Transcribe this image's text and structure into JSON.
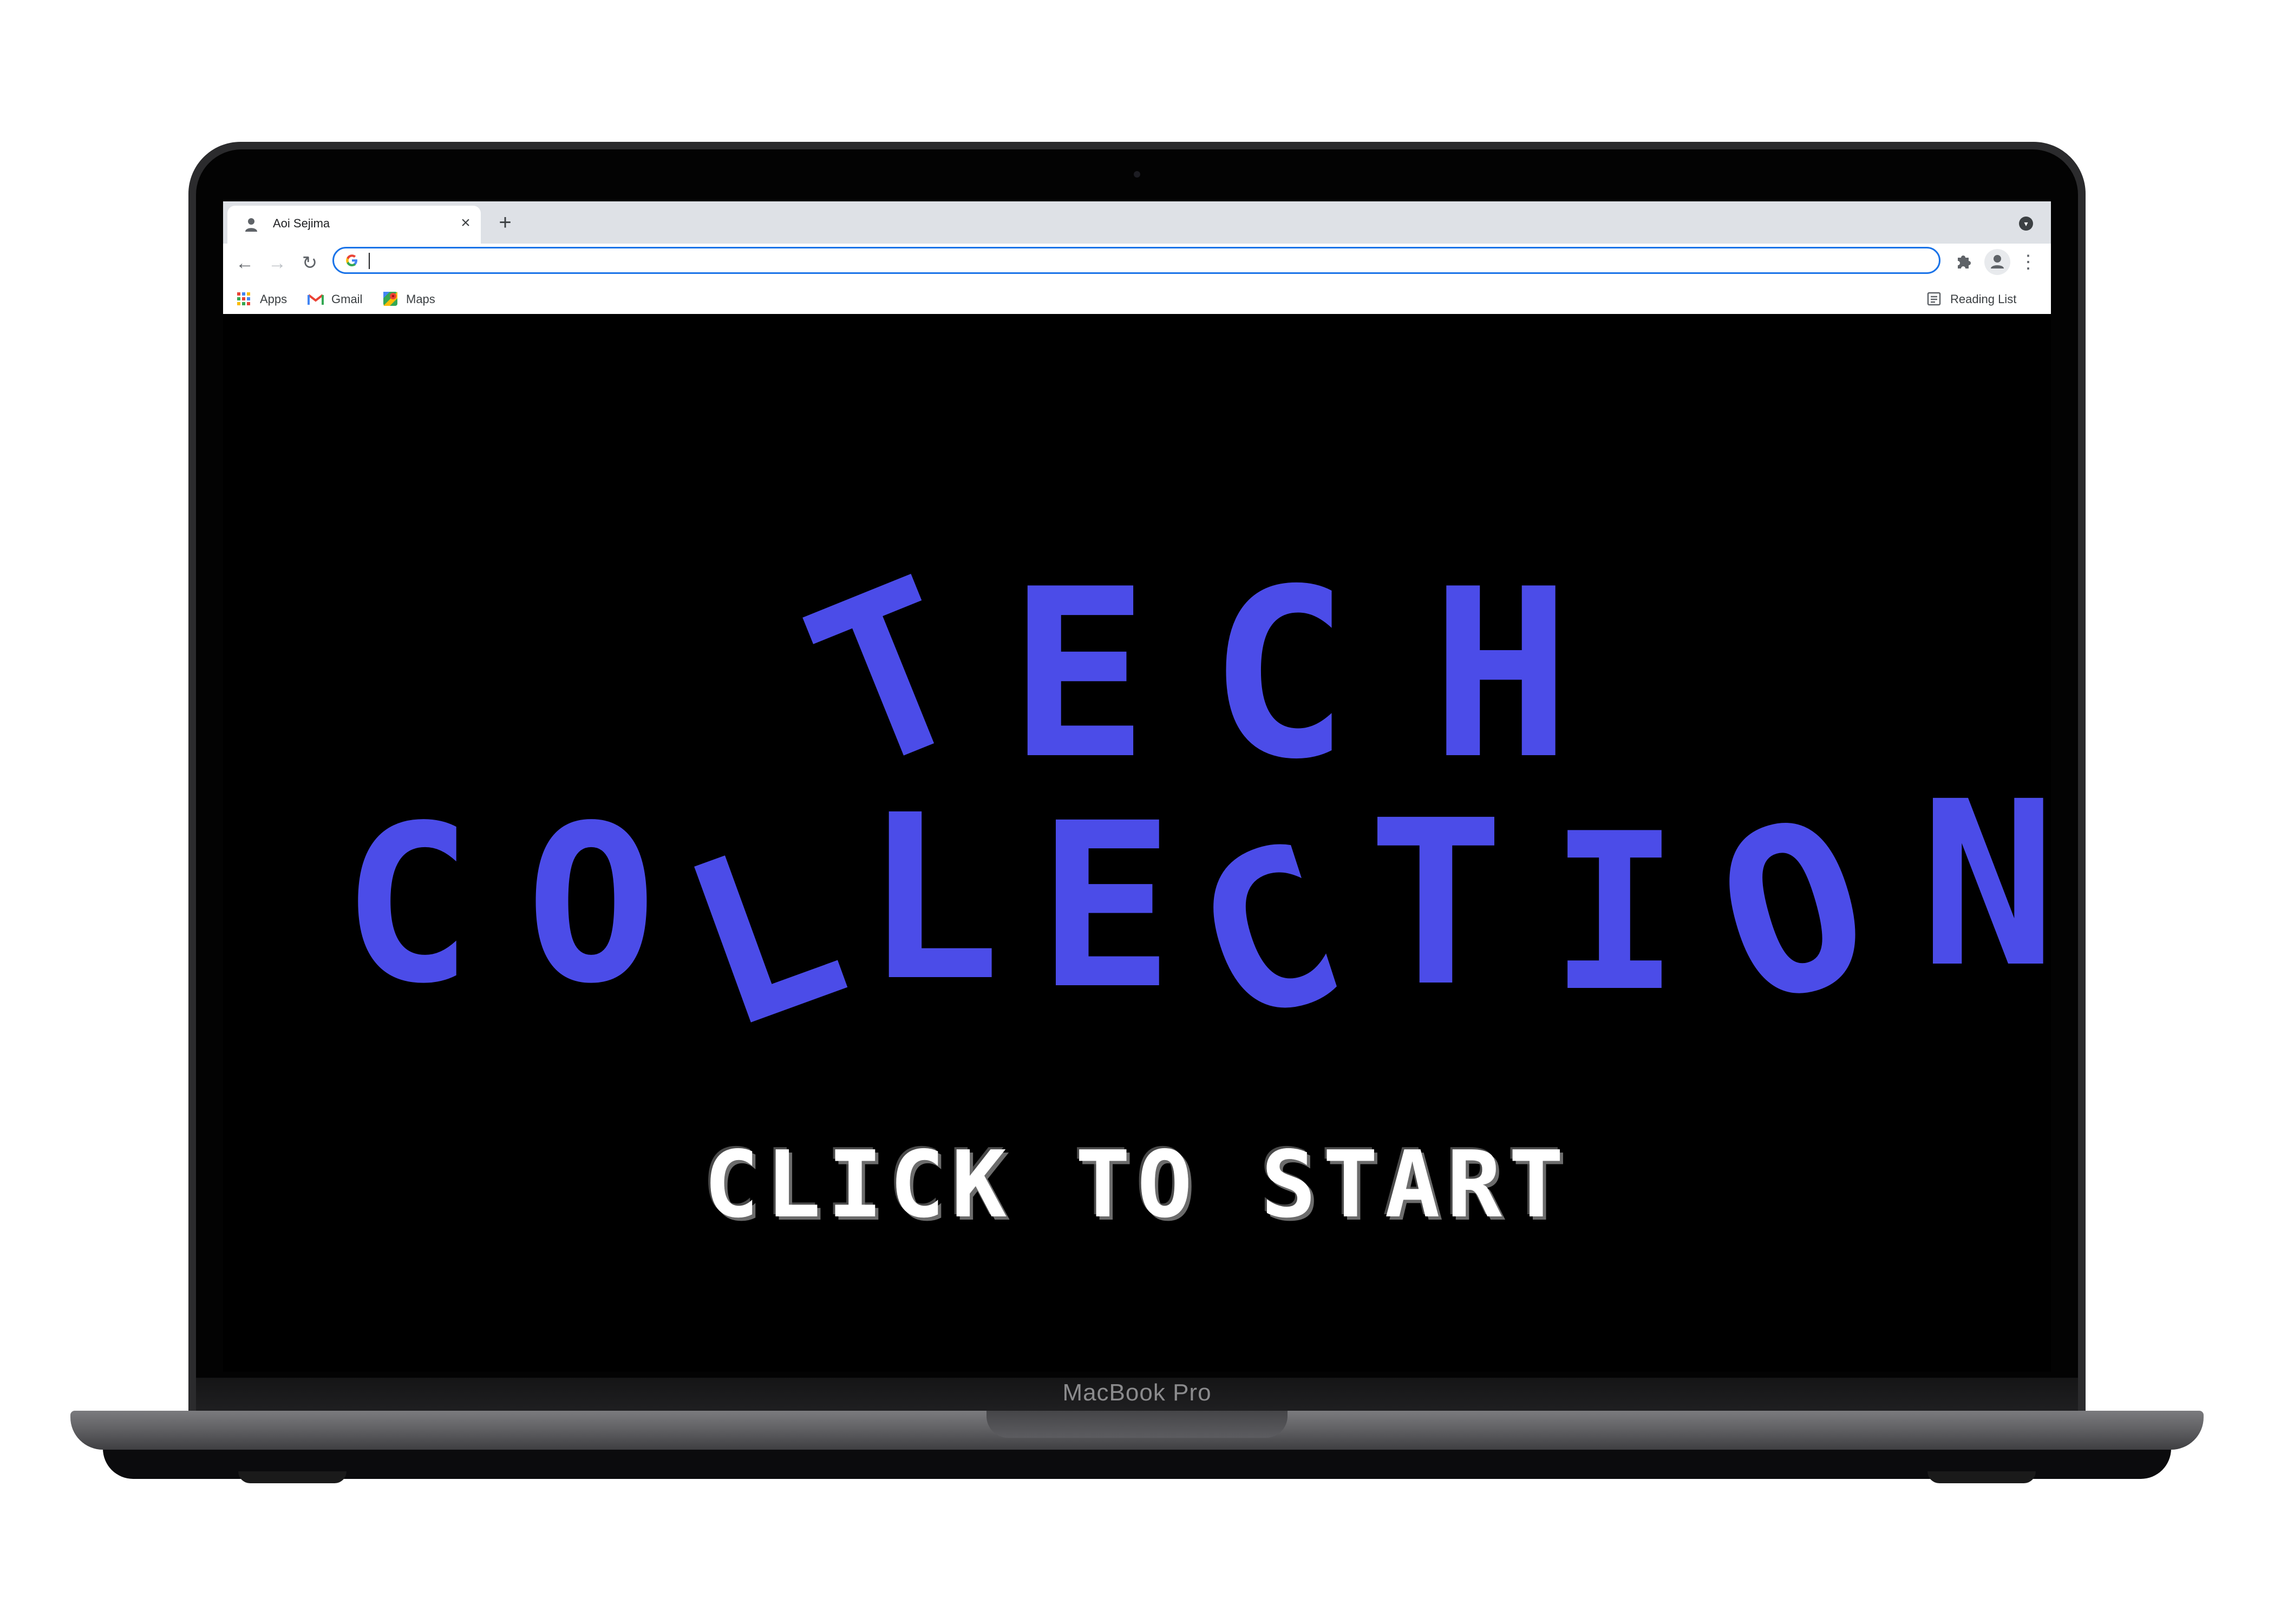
{
  "browser": {
    "tab_title": "Aoi Sejima",
    "tab_close": "×",
    "new_tab": "+",
    "address_value": "",
    "bookmarks": [
      {
        "label": "Apps",
        "icon": "apps-grid-icon"
      },
      {
        "label": "Gmail",
        "icon": "gmail-icon"
      },
      {
        "label": "Maps",
        "icon": "maps-icon"
      }
    ],
    "reading_list": "Reading List",
    "accent": "#1a73e8"
  },
  "game": {
    "title_words": [
      "TECH",
      "COLLECTION"
    ],
    "start_prompt": "CLICK TO START",
    "title_color": "#4b4ce8",
    "background": "#000000"
  },
  "device": {
    "model": "MacBook Pro"
  }
}
